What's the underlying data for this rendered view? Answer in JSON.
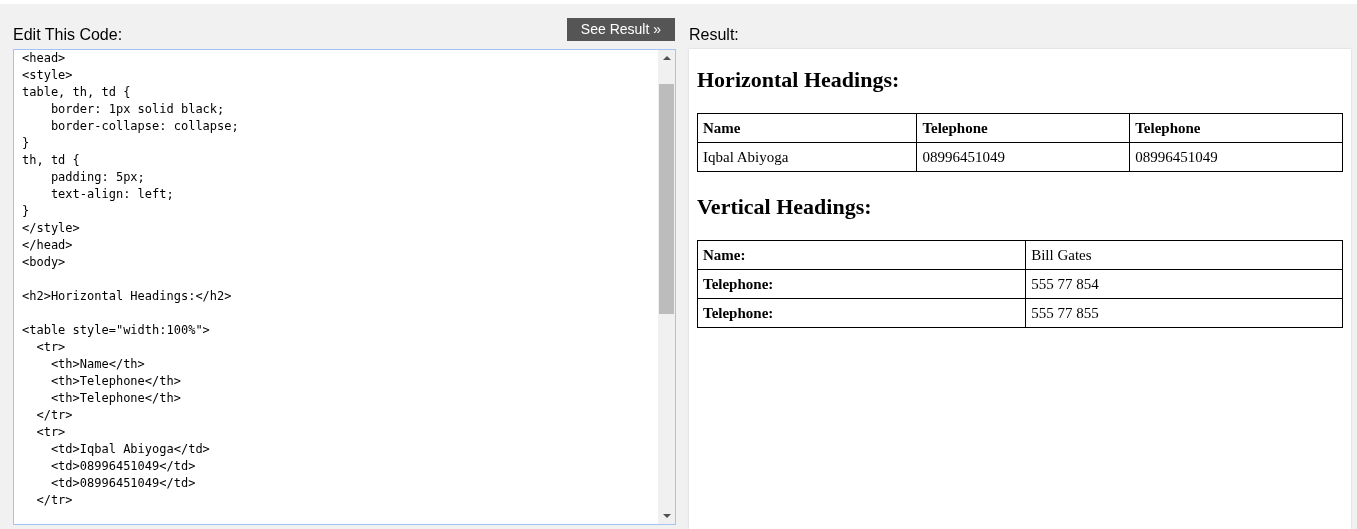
{
  "editor": {
    "label": "Edit This Code:",
    "run_button": "See Result »",
    "code_blocks": [
      [
        "<head>",
        "<style>",
        "table, th, td {",
        "    border: 1px solid black;",
        "    border-collapse: collapse;",
        "}",
        "th, td {",
        "    padding: 5px;",
        "    text-align: left;",
        "}",
        "</style>",
        "</head>",
        "<body>"
      ],
      [
        "<h2>Horizontal Headings:</h2>"
      ],
      [
        "<table style=\"width:100%\">",
        "  <tr>",
        "    <th>Name</th>",
        "    <th>Telephone</th>",
        "    <th>Telephone</th>",
        "  </tr>",
        "  <tr>",
        "    <td>Iqbal Abiyoga</td>",
        "    <td>08996451049</td>",
        "    <td>08996451049</td>",
        "  </tr>"
      ]
    ]
  },
  "result": {
    "label": "Result:",
    "sections": [
      {
        "heading": "Horizontal Headings:",
        "kind": "horizontal",
        "header": [
          "Name",
          "Telephone",
          "Telephone"
        ],
        "rows": [
          [
            "Iqbal Abiyoga",
            "08996451049",
            "08996451049"
          ]
        ]
      },
      {
        "heading": "Vertical Headings:",
        "kind": "vertical",
        "rows": [
          [
            "Name:",
            "Bill Gates"
          ],
          [
            "Telephone:",
            "555 77 854"
          ],
          [
            "Telephone:",
            "555 77 855"
          ]
        ]
      }
    ]
  }
}
